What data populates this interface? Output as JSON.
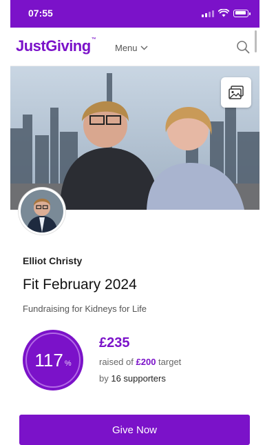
{
  "status_bar": {
    "time": "07:55"
  },
  "header": {
    "logo_text": "JustGiving",
    "logo_mark": "™",
    "menu_label": "Menu",
    "search_icon": "search-icon",
    "brand_color": "#7b12c9"
  },
  "hero": {
    "photo_button_icon": "image-icon"
  },
  "page": {
    "owner_name": "Elliot Christy",
    "title": "Fit February 2024",
    "cause_line": "Fundraising for Kidneys for Life"
  },
  "progress": {
    "percent": "117",
    "percent_symbol": "%",
    "raised_amount": "£235",
    "raised_prefix": "raised of",
    "target_amount": "£200",
    "target_suffix": "target",
    "supporters_prefix": "by",
    "supporters_text": "16 supporters"
  },
  "actions": {
    "give_now_label": "Give Now"
  }
}
